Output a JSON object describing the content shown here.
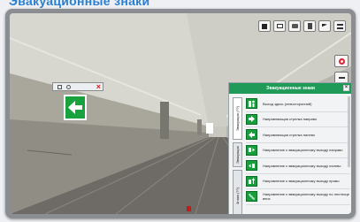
{
  "page": {
    "title": "Эвакуационные знаки"
  },
  "toolbar": {
    "buttons": [
      "Информация",
      "Скриншот",
      "Камера",
      "Двери",
      "Вход",
      "Меню"
    ]
  },
  "widget": {
    "close": "×"
  },
  "panel": {
    "title": "Эвакуационные знаки",
    "close": "×",
    "tabs": [
      "Эвакуация (??)",
      "Эвакуация",
      "Знаки (??)"
    ],
    "items": [
      "Выход здесь (левосторонний)",
      "Направляющая стрелка направо",
      "Направляющая стрелка налево",
      "Направление к эвакуационному выходу направо",
      "Направление к эвакуационному выходу налево",
      "Направление к эвакуационному выходу прямо",
      "Направление к эвакуационному выходу по лестнице вниз"
    ]
  },
  "colors": {
    "accent": "#1f9a58",
    "sign_green": "#17a23d",
    "title_blue": "#2b7fd0"
  }
}
